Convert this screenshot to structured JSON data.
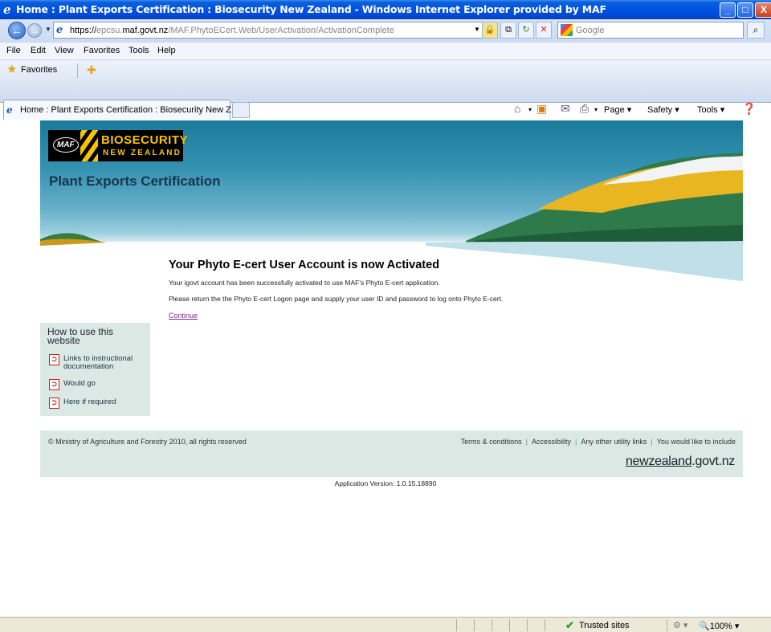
{
  "window": {
    "title": "Home : Plant Exports Certification : Biosecurity New Zealand - Windows Internet Explorer provided by MAF",
    "controls": [
      "_",
      "□",
      "X"
    ]
  },
  "address": {
    "url_prefix": "https://",
    "url_sub": "epcsu.",
    "url_domain": "maf.govt.nz",
    "url_path": "/MAF.PhytoECert.Web/UserActivation/ActivationComplete",
    "search_placeholder": "Google"
  },
  "menu": [
    "File",
    "Edit",
    "View",
    "Favorites",
    "Tools",
    "Help"
  ],
  "favorites_label": "Favorites",
  "tab": {
    "label": "Home : Plant Exports Certification : Biosecurity New Z..."
  },
  "command_bar": {
    "page": "Page",
    "safety": "Safety",
    "tools": "Tools"
  },
  "site": {
    "logo_line1": "BIOSECURITY",
    "logo_line2": "NEW ZEALAND",
    "logo_maf": "MAF",
    "title": "Plant Exports Certification"
  },
  "content": {
    "heading": "Your Phyto E-cert User Account is now Activated",
    "para1": "Your igovt account has been successfully activated to use MAF's Phyto E-cert application.",
    "para2": "Please return the the Phyto E-cert Logon page and supply your user ID and password to log onto Phyto E-cert.",
    "continue_link": "Continue"
  },
  "sidebar": {
    "heading": "How to use this website",
    "links": [
      {
        "label": "Links to instructional documentation"
      },
      {
        "label": "Would go"
      },
      {
        "label": "Here if required"
      }
    ]
  },
  "footer": {
    "copyright": "© Ministry of Agriculture and Forestry 2010, all rights reserved",
    "utility_links": [
      "Terms & conditions",
      "Accessibility",
      "Any other utility links",
      "You would like to include"
    ],
    "nz_logo_a": "newzealand",
    "nz_logo_b": ".govt.nz",
    "app_version": "Application Version: 1.0.15.18890"
  },
  "status": {
    "zone": "Trusted sites",
    "zoom": "100%"
  },
  "colors": {
    "titlebar": "#0053e1",
    "brand_yellow": "#f7c300",
    "panel": "#dbe9e5",
    "link_visited": "#7b2c85"
  }
}
